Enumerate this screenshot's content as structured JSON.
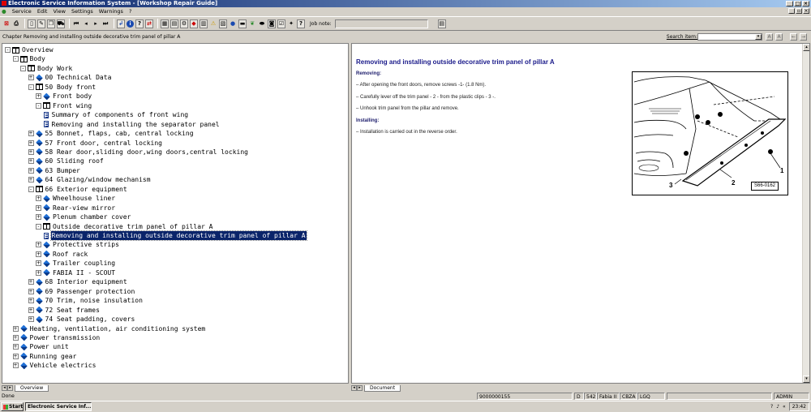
{
  "window": {
    "title": "Electronic Service Information System - [Workshop Repair Guide]"
  },
  "menu": [
    "Service",
    "Edit",
    "View",
    "Settings",
    "Warnings",
    "?"
  ],
  "toolbar": {
    "job_note_label": "Job note:"
  },
  "chapter": {
    "text": "Chapter Removing and installing outside decorative trim panel of pillar A"
  },
  "search": {
    "label": "Search item:",
    "value": ""
  },
  "tree": [
    {
      "label": "Overview",
      "depth": 0,
      "toggle": "-",
      "icon": "open"
    },
    {
      "label": "Body",
      "depth": 1,
      "toggle": "-",
      "icon": "open"
    },
    {
      "label": "Body Work",
      "depth": 2,
      "toggle": "-",
      "icon": "open"
    },
    {
      "label": "00 Technical Data",
      "depth": 3,
      "toggle": "+",
      "icon": "closed"
    },
    {
      "label": "50 Body front",
      "depth": 3,
      "toggle": "-",
      "icon": "open"
    },
    {
      "label": "Front body",
      "depth": 4,
      "toggle": "+",
      "icon": "closed"
    },
    {
      "label": "Front wing",
      "depth": 4,
      "toggle": "-",
      "icon": "open"
    },
    {
      "label": "Summary of components of front wing",
      "depth": 5,
      "toggle": "",
      "icon": "doc"
    },
    {
      "label": "Removing and installing the separator panel",
      "depth": 5,
      "toggle": "",
      "icon": "doc"
    },
    {
      "label": "55 Bonnet, flaps, cab, central locking",
      "depth": 3,
      "toggle": "+",
      "icon": "closed"
    },
    {
      "label": "57 Front door, central locking",
      "depth": 3,
      "toggle": "+",
      "icon": "closed"
    },
    {
      "label": "58 Rear door,sliding door,wing doors,central locking",
      "depth": 3,
      "toggle": "+",
      "icon": "closed"
    },
    {
      "label": "60 Sliding roof",
      "depth": 3,
      "toggle": "+",
      "icon": "closed"
    },
    {
      "label": "63 Bumper",
      "depth": 3,
      "toggle": "+",
      "icon": "closed"
    },
    {
      "label": "64 Glazing/window mechanism",
      "depth": 3,
      "toggle": "+",
      "icon": "closed"
    },
    {
      "label": "66 Exterior equipment",
      "depth": 3,
      "toggle": "-",
      "icon": "open"
    },
    {
      "label": "Wheelhouse liner",
      "depth": 4,
      "toggle": "+",
      "icon": "closed"
    },
    {
      "label": "Rear-view mirror",
      "depth": 4,
      "toggle": "+",
      "icon": "closed"
    },
    {
      "label": "Plenum chamber cover",
      "depth": 4,
      "toggle": "+",
      "icon": "closed"
    },
    {
      "label": "Outside decorative trim panel of pillar A",
      "depth": 4,
      "toggle": "-",
      "icon": "open"
    },
    {
      "label": "Removing and installing outside decorative trim panel of pillar A",
      "depth": 5,
      "toggle": "",
      "icon": "doc",
      "selected": true
    },
    {
      "label": "Protective strips",
      "depth": 4,
      "toggle": "+",
      "icon": "closed"
    },
    {
      "label": "Roof rack",
      "depth": 4,
      "toggle": "+",
      "icon": "closed"
    },
    {
      "label": "Trailer coupling",
      "depth": 4,
      "toggle": "+",
      "icon": "closed"
    },
    {
      "label": "FABIA II - SCOUT",
      "depth": 4,
      "toggle": "+",
      "icon": "closed"
    },
    {
      "label": "68 Interior equipment",
      "depth": 3,
      "toggle": "+",
      "icon": "closed"
    },
    {
      "label": "69 Passenger protection",
      "depth": 3,
      "toggle": "+",
      "icon": "closed"
    },
    {
      "label": "70 Trim, noise insulation",
      "depth": 3,
      "toggle": "+",
      "icon": "closed"
    },
    {
      "label": "72 Seat frames",
      "depth": 3,
      "toggle": "+",
      "icon": "closed"
    },
    {
      "label": "74 Seat padding, covers",
      "depth": 3,
      "toggle": "+",
      "icon": "closed"
    },
    {
      "label": "Heating, ventilation, air conditioning system",
      "depth": 1,
      "toggle": "+",
      "icon": "closed"
    },
    {
      "label": "Power transmission",
      "depth": 1,
      "toggle": "+",
      "icon": "closed"
    },
    {
      "label": "Power unit",
      "depth": 1,
      "toggle": "+",
      "icon": "closed"
    },
    {
      "label": "Running gear",
      "depth": 1,
      "toggle": "+",
      "icon": "closed"
    },
    {
      "label": "Vehicle electrics",
      "depth": 1,
      "toggle": "+",
      "icon": "closed"
    }
  ],
  "left_tab": {
    "label": "Overview"
  },
  "document": {
    "title": "Removing and installing outside decorative trim panel of pillar A",
    "removing_heading": "Removing:",
    "steps_removing": [
      "–   After opening the front doors, remove screws -1- (1.8 Nm).",
      "–   Carefully lever off the trim panel - 2 - from the plastic clips - 3 -.",
      "–   Unhook trim panel from the pillar and remove."
    ],
    "installing_heading": "Installing:",
    "steps_installing": [
      "–   Installation is carried out in the reverse order."
    ],
    "figure": {
      "labels": [
        "1",
        "2",
        "3"
      ],
      "id": "S66-0162"
    }
  },
  "right_tab": {
    "label": "Document"
  },
  "status": {
    "state": "Done",
    "order_no": "9000000155",
    "d": "D",
    "code": "542",
    "model": "Fabia II",
    "engine": "CBZA",
    "gear": "LGQ",
    "user": "ADMIN"
  },
  "taskbar": {
    "start": "Start",
    "app": "Electronic Service Inf...",
    "clock": "23:42"
  }
}
